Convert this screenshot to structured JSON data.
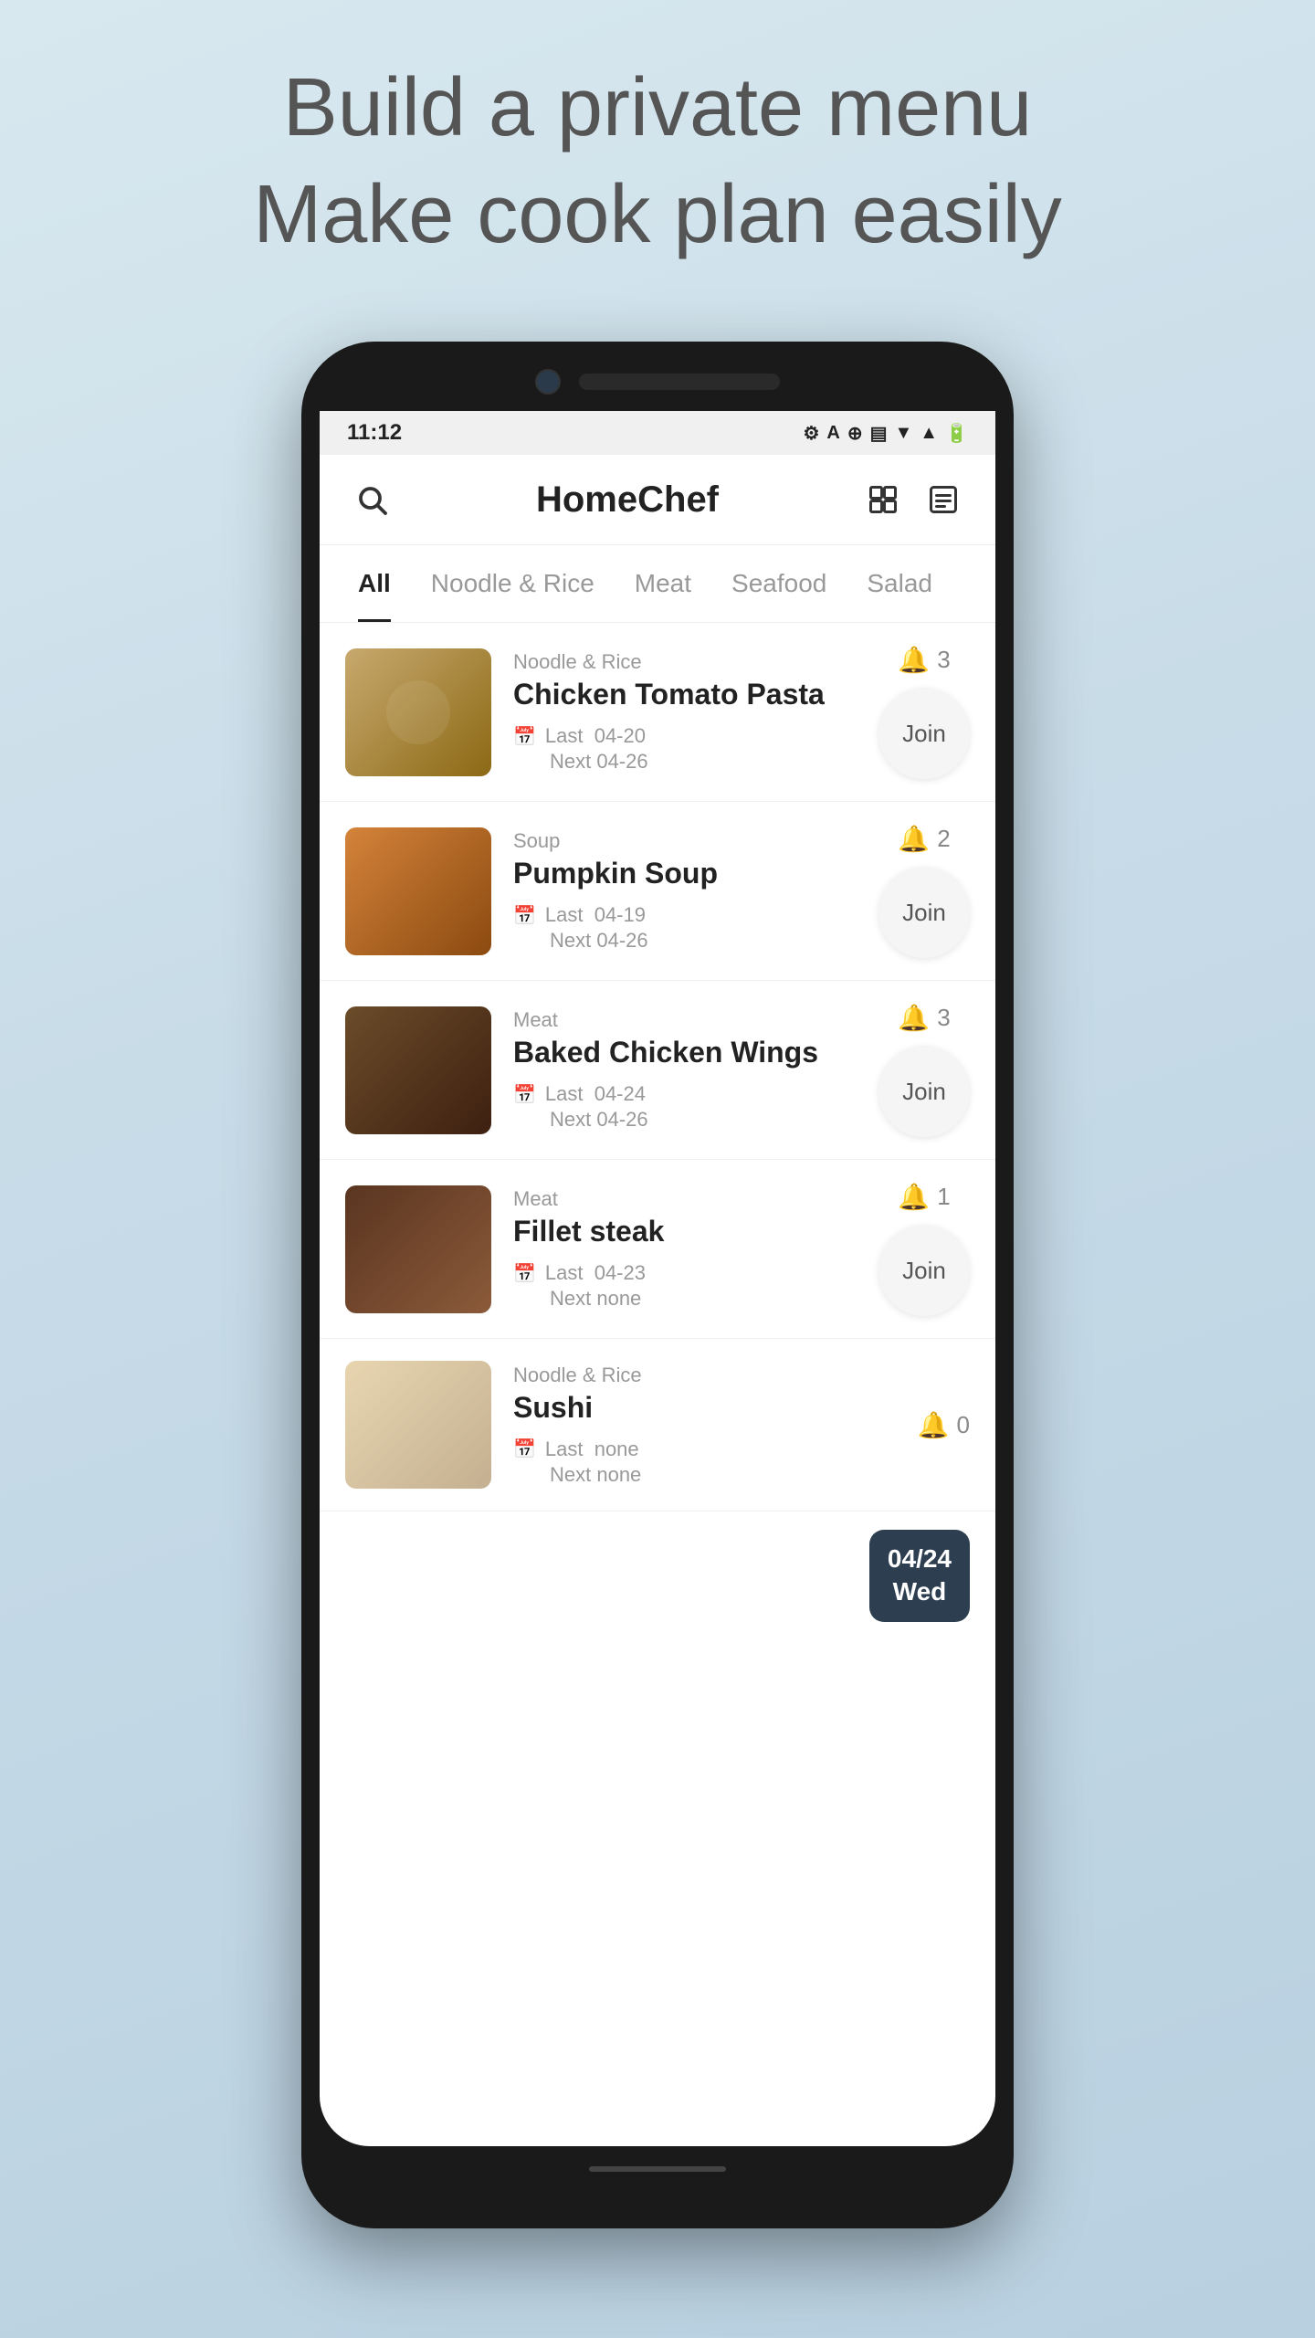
{
  "headline": {
    "line1": "Build a private menu",
    "line2": "Make cook plan easily"
  },
  "status_bar": {
    "time": "11:12",
    "icons": [
      "⚙",
      "A",
      "⊕",
      "🔋"
    ]
  },
  "app": {
    "title": "HomeChef",
    "tabs": [
      {
        "label": "All",
        "active": true
      },
      {
        "label": "Noodle & Rice",
        "active": false
      },
      {
        "label": "Meat",
        "active": false
      },
      {
        "label": "Seafood",
        "active": false
      },
      {
        "label": "Salad",
        "active": false
      }
    ],
    "recipes": [
      {
        "id": "pasta",
        "category": "Noodle & Rice",
        "name": "Chicken Tomato Pasta",
        "last": "04-20",
        "next": "04-26",
        "servings": 3,
        "food_class": "food-pasta"
      },
      {
        "id": "soup",
        "category": "Soup",
        "name": "Pumpkin Soup",
        "last": "04-19",
        "next": "04-26",
        "servings": 2,
        "food_class": "food-soup"
      },
      {
        "id": "wings",
        "category": "Meat",
        "name": "Baked Chicken Wings",
        "last": "04-24",
        "next": "04-26",
        "servings": 3,
        "food_class": "food-chicken"
      },
      {
        "id": "steak",
        "category": "Meat",
        "name": "Fillet steak",
        "last": "04-23",
        "next": "none",
        "servings": 1,
        "food_class": "food-steak"
      },
      {
        "id": "sushi",
        "category": "Noodle & Rice",
        "name": "Sushi",
        "last": "none",
        "next": "none",
        "servings": 0,
        "food_class": "food-sushi"
      }
    ],
    "join_label": "Join",
    "last_prefix": "Last",
    "next_prefix": "Next"
  },
  "date_badge": {
    "date": "04/24",
    "day": "Wed"
  }
}
